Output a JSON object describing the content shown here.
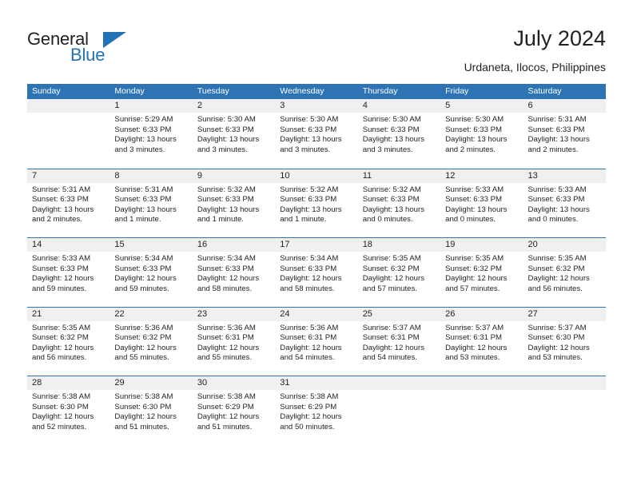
{
  "brand": {
    "name_top": "General",
    "name_bottom": "Blue",
    "accent_color": "#2272b8"
  },
  "header": {
    "title": "July 2024",
    "subtitle": "Urdaneta, Ilocos, Philippines"
  },
  "theme": {
    "header_blue": "#2e74b5",
    "day_band_gray": "#f0f0f0",
    "text_color": "#231f20"
  },
  "calendar": {
    "weekday_headers": [
      "Sunday",
      "Monday",
      "Tuesday",
      "Wednesday",
      "Thursday",
      "Friday",
      "Saturday"
    ],
    "weeks": [
      [
        {
          "day": "",
          "sunrise": "",
          "sunset": "",
          "daylight": "",
          "daylight2": "",
          "empty": true
        },
        {
          "day": "1",
          "sunrise": "Sunrise: 5:29 AM",
          "sunset": "Sunset: 6:33 PM",
          "daylight": "Daylight: 13 hours",
          "daylight2": "and 3 minutes."
        },
        {
          "day": "2",
          "sunrise": "Sunrise: 5:30 AM",
          "sunset": "Sunset: 6:33 PM",
          "daylight": "Daylight: 13 hours",
          "daylight2": "and 3 minutes."
        },
        {
          "day": "3",
          "sunrise": "Sunrise: 5:30 AM",
          "sunset": "Sunset: 6:33 PM",
          "daylight": "Daylight: 13 hours",
          "daylight2": "and 3 minutes."
        },
        {
          "day": "4",
          "sunrise": "Sunrise: 5:30 AM",
          "sunset": "Sunset: 6:33 PM",
          "daylight": "Daylight: 13 hours",
          "daylight2": "and 3 minutes."
        },
        {
          "day": "5",
          "sunrise": "Sunrise: 5:30 AM",
          "sunset": "Sunset: 6:33 PM",
          "daylight": "Daylight: 13 hours",
          "daylight2": "and 2 minutes."
        },
        {
          "day": "6",
          "sunrise": "Sunrise: 5:31 AM",
          "sunset": "Sunset: 6:33 PM",
          "daylight": "Daylight: 13 hours",
          "daylight2": "and 2 minutes."
        }
      ],
      [
        {
          "day": "7",
          "sunrise": "Sunrise: 5:31 AM",
          "sunset": "Sunset: 6:33 PM",
          "daylight": "Daylight: 13 hours",
          "daylight2": "and 2 minutes."
        },
        {
          "day": "8",
          "sunrise": "Sunrise: 5:31 AM",
          "sunset": "Sunset: 6:33 PM",
          "daylight": "Daylight: 13 hours",
          "daylight2": "and 1 minute."
        },
        {
          "day": "9",
          "sunrise": "Sunrise: 5:32 AM",
          "sunset": "Sunset: 6:33 PM",
          "daylight": "Daylight: 13 hours",
          "daylight2": "and 1 minute."
        },
        {
          "day": "10",
          "sunrise": "Sunrise: 5:32 AM",
          "sunset": "Sunset: 6:33 PM",
          "daylight": "Daylight: 13 hours",
          "daylight2": "and 1 minute."
        },
        {
          "day": "11",
          "sunrise": "Sunrise: 5:32 AM",
          "sunset": "Sunset: 6:33 PM",
          "daylight": "Daylight: 13 hours",
          "daylight2": "and 0 minutes."
        },
        {
          "day": "12",
          "sunrise": "Sunrise: 5:33 AM",
          "sunset": "Sunset: 6:33 PM",
          "daylight": "Daylight: 13 hours",
          "daylight2": "and 0 minutes."
        },
        {
          "day": "13",
          "sunrise": "Sunrise: 5:33 AM",
          "sunset": "Sunset: 6:33 PM",
          "daylight": "Daylight: 13 hours",
          "daylight2": "and 0 minutes."
        }
      ],
      [
        {
          "day": "14",
          "sunrise": "Sunrise: 5:33 AM",
          "sunset": "Sunset: 6:33 PM",
          "daylight": "Daylight: 12 hours",
          "daylight2": "and 59 minutes."
        },
        {
          "day": "15",
          "sunrise": "Sunrise: 5:34 AM",
          "sunset": "Sunset: 6:33 PM",
          "daylight": "Daylight: 12 hours",
          "daylight2": "and 59 minutes."
        },
        {
          "day": "16",
          "sunrise": "Sunrise: 5:34 AM",
          "sunset": "Sunset: 6:33 PM",
          "daylight": "Daylight: 12 hours",
          "daylight2": "and 58 minutes."
        },
        {
          "day": "17",
          "sunrise": "Sunrise: 5:34 AM",
          "sunset": "Sunset: 6:33 PM",
          "daylight": "Daylight: 12 hours",
          "daylight2": "and 58 minutes."
        },
        {
          "day": "18",
          "sunrise": "Sunrise: 5:35 AM",
          "sunset": "Sunset: 6:32 PM",
          "daylight": "Daylight: 12 hours",
          "daylight2": "and 57 minutes."
        },
        {
          "day": "19",
          "sunrise": "Sunrise: 5:35 AM",
          "sunset": "Sunset: 6:32 PM",
          "daylight": "Daylight: 12 hours",
          "daylight2": "and 57 minutes."
        },
        {
          "day": "20",
          "sunrise": "Sunrise: 5:35 AM",
          "sunset": "Sunset: 6:32 PM",
          "daylight": "Daylight: 12 hours",
          "daylight2": "and 56 minutes."
        }
      ],
      [
        {
          "day": "21",
          "sunrise": "Sunrise: 5:35 AM",
          "sunset": "Sunset: 6:32 PM",
          "daylight": "Daylight: 12 hours",
          "daylight2": "and 56 minutes."
        },
        {
          "day": "22",
          "sunrise": "Sunrise: 5:36 AM",
          "sunset": "Sunset: 6:32 PM",
          "daylight": "Daylight: 12 hours",
          "daylight2": "and 55 minutes."
        },
        {
          "day": "23",
          "sunrise": "Sunrise: 5:36 AM",
          "sunset": "Sunset: 6:31 PM",
          "daylight": "Daylight: 12 hours",
          "daylight2": "and 55 minutes."
        },
        {
          "day": "24",
          "sunrise": "Sunrise: 5:36 AM",
          "sunset": "Sunset: 6:31 PM",
          "daylight": "Daylight: 12 hours",
          "daylight2": "and 54 minutes."
        },
        {
          "day": "25",
          "sunrise": "Sunrise: 5:37 AM",
          "sunset": "Sunset: 6:31 PM",
          "daylight": "Daylight: 12 hours",
          "daylight2": "and 54 minutes."
        },
        {
          "day": "26",
          "sunrise": "Sunrise: 5:37 AM",
          "sunset": "Sunset: 6:31 PM",
          "daylight": "Daylight: 12 hours",
          "daylight2": "and 53 minutes."
        },
        {
          "day": "27",
          "sunrise": "Sunrise: 5:37 AM",
          "sunset": "Sunset: 6:30 PM",
          "daylight": "Daylight: 12 hours",
          "daylight2": "and 53 minutes."
        }
      ],
      [
        {
          "day": "28",
          "sunrise": "Sunrise: 5:38 AM",
          "sunset": "Sunset: 6:30 PM",
          "daylight": "Daylight: 12 hours",
          "daylight2": "and 52 minutes."
        },
        {
          "day": "29",
          "sunrise": "Sunrise: 5:38 AM",
          "sunset": "Sunset: 6:30 PM",
          "daylight": "Daylight: 12 hours",
          "daylight2": "and 51 minutes."
        },
        {
          "day": "30",
          "sunrise": "Sunrise: 5:38 AM",
          "sunset": "Sunset: 6:29 PM",
          "daylight": "Daylight: 12 hours",
          "daylight2": "and 51 minutes."
        },
        {
          "day": "31",
          "sunrise": "Sunrise: 5:38 AM",
          "sunset": "Sunset: 6:29 PM",
          "daylight": "Daylight: 12 hours",
          "daylight2": "and 50 minutes."
        },
        {
          "day": "",
          "sunrise": "",
          "sunset": "",
          "daylight": "",
          "daylight2": "",
          "empty": true
        },
        {
          "day": "",
          "sunrise": "",
          "sunset": "",
          "daylight": "",
          "daylight2": "",
          "empty": true
        },
        {
          "day": "",
          "sunrise": "",
          "sunset": "",
          "daylight": "",
          "daylight2": "",
          "empty": true
        }
      ]
    ]
  }
}
